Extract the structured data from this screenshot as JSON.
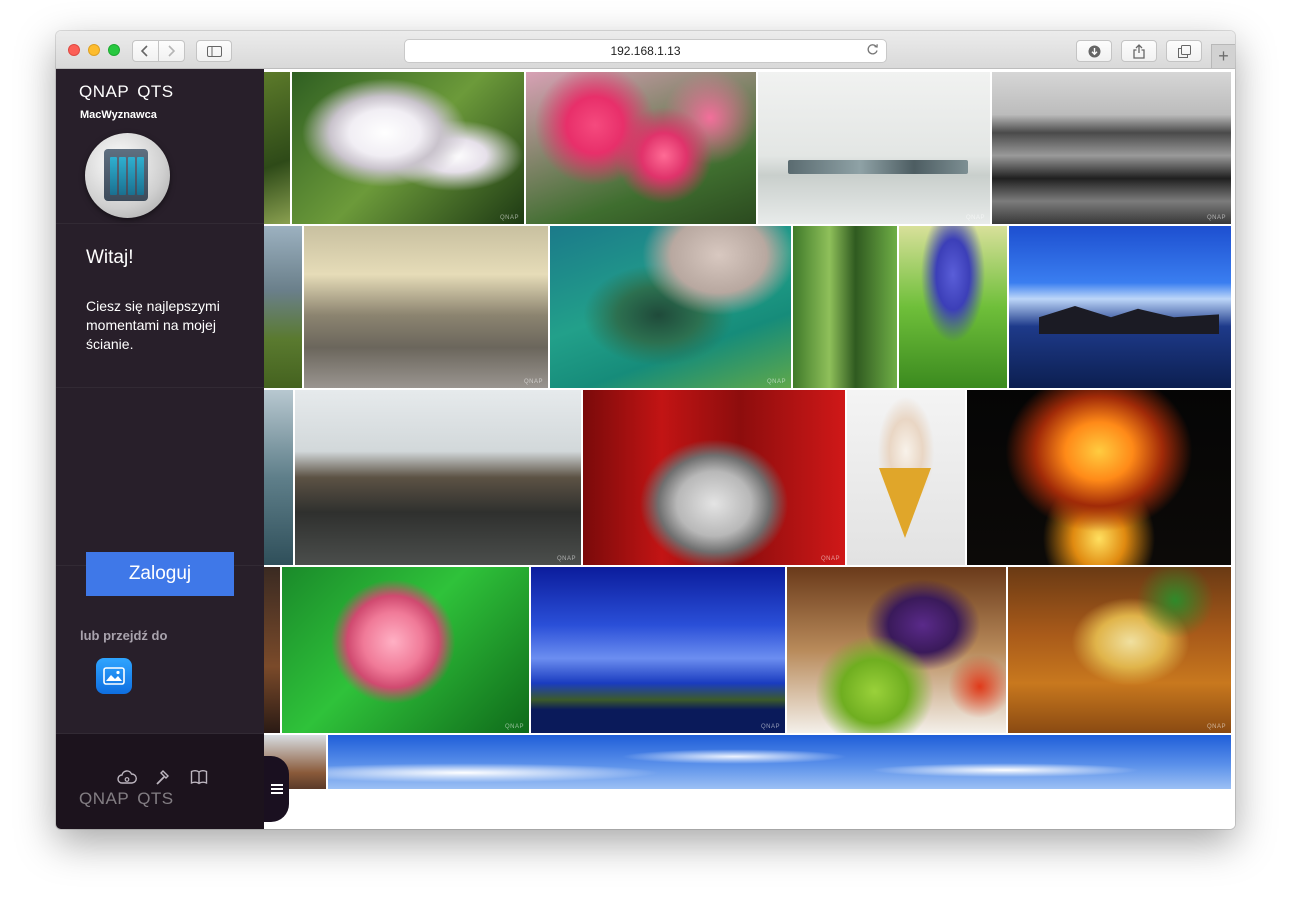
{
  "browser": {
    "url": "192.168.1.13",
    "icons": {
      "back": "chevron-left-icon",
      "forward": "chevron-right-icon",
      "sidebar": "sidebar-icon",
      "reload": "reload-icon",
      "downloads": "download-icon",
      "share": "share-icon",
      "tabs": "tabs-icon",
      "new_tab": "plus-icon"
    }
  },
  "sidebar": {
    "brand_left": "QNAP",
    "brand_right": "QTS",
    "device_name": "MacWyznawca",
    "welcome_title": "Witaj!",
    "welcome_text": "Ciesz się najlepszymi momentami na mojej ścianie.",
    "login_label": "Zaloguj",
    "or_go_label": "lub przejdź do",
    "accent_color": "#3f78e8"
  },
  "watermark": "QNAP"
}
